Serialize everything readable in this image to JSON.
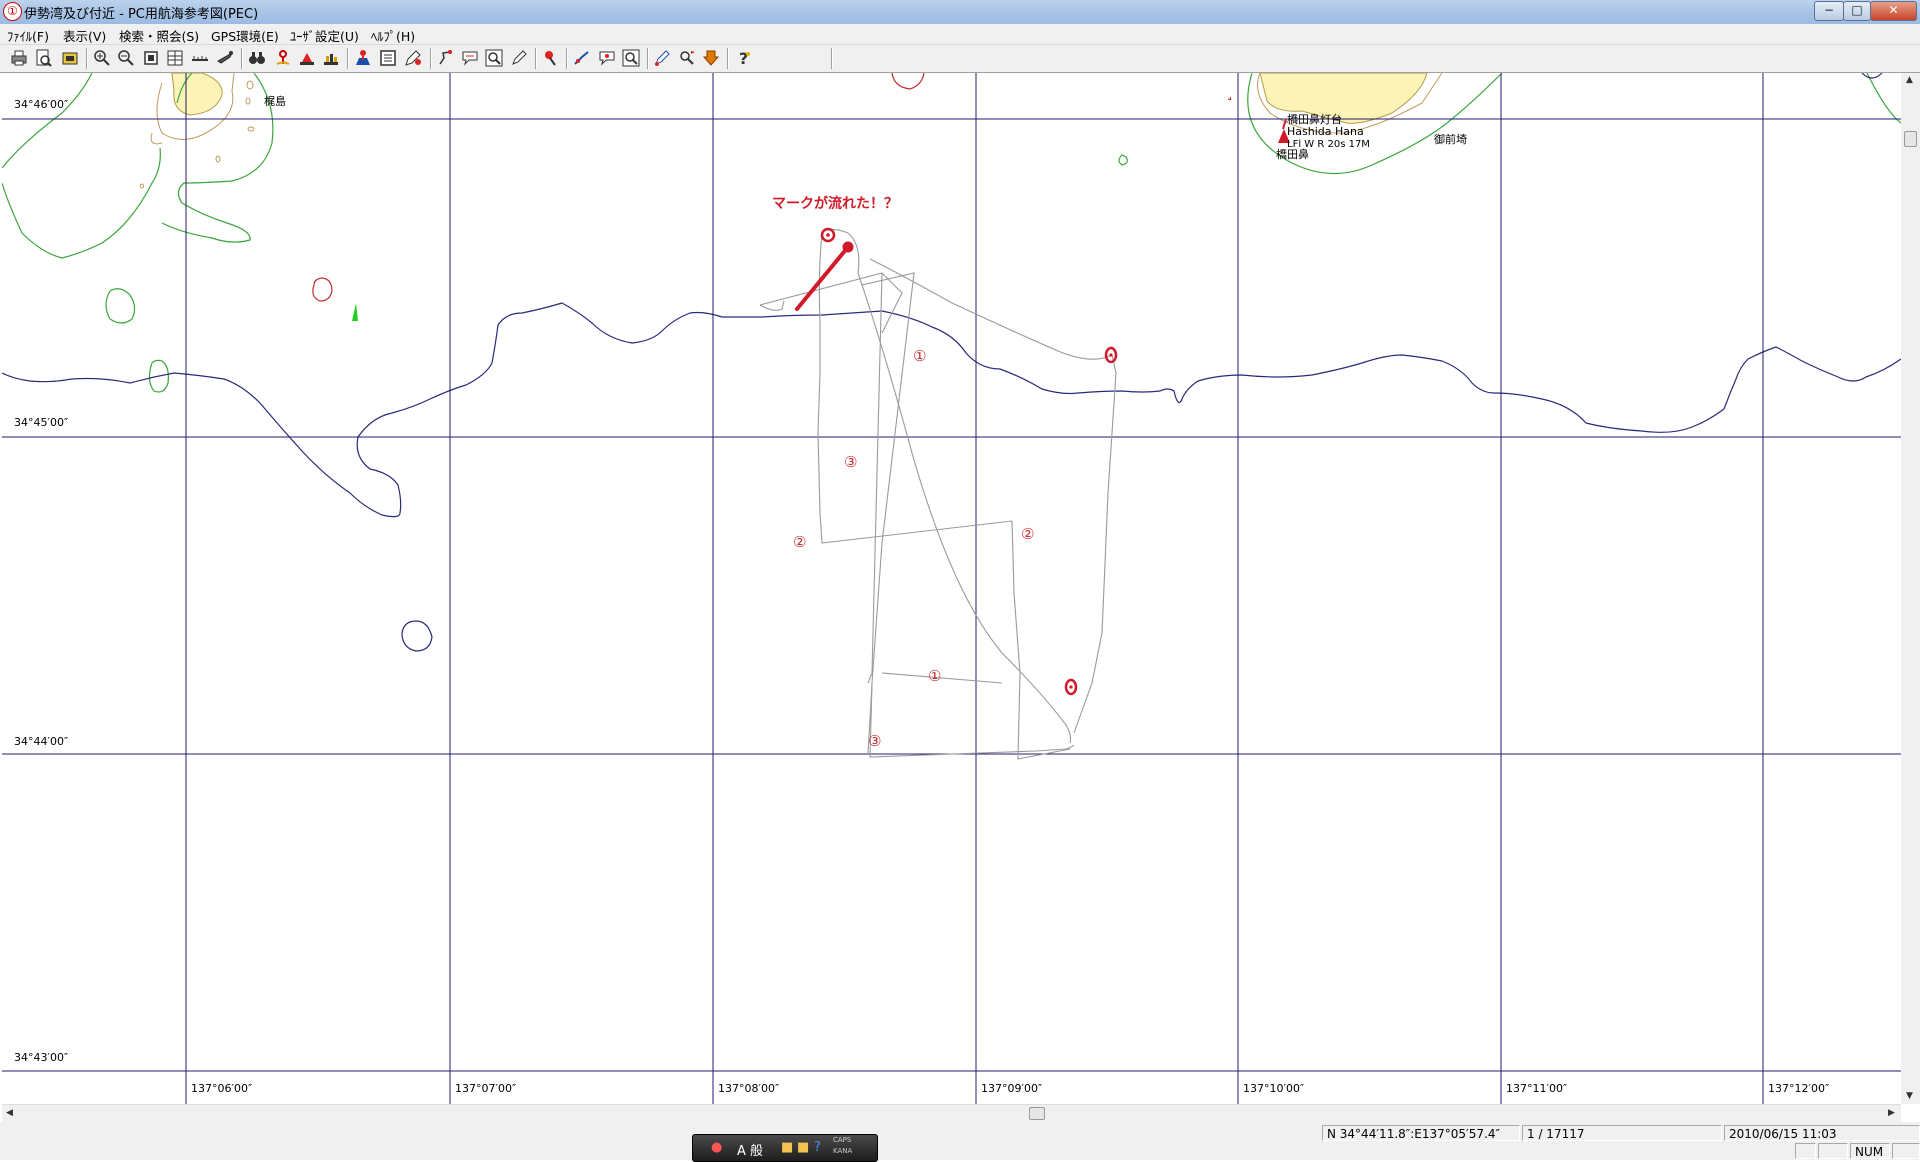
{
  "window": {
    "title": "伊勢湾及び付近 - PC用航海参考図(PEC)",
    "app_icon": "circled-one-icon",
    "controls": {
      "minimize": "−",
      "maximize": "□",
      "close": "✕"
    }
  },
  "menu": [
    "ﾌｧｲﾙ(F)",
    "表示(V)",
    "検索・照会(S)",
    "GPS環境(E)",
    "ﾕｰｻﾞ設定(U)",
    "ﾍﾙﾌﾟ(H)"
  ],
  "toolbar": {
    "icons": [
      "printer-icon",
      "print-preview-icon",
      "save-icon",
      "zoom-in-icon",
      "zoom-out-icon",
      "fit-window-icon",
      "layers-icon",
      "scale-ruler-icon",
      "ship-icon",
      "binoculars-icon",
      "tide-icon",
      "buoy-icon",
      "lighthouse-icon",
      "person-marker-icon",
      "document-icon",
      "edit-mark-icon",
      "route-icon",
      "note-icon",
      "magnifier-icon",
      "pencil-icon",
      "pin-icon",
      "track-icon",
      "comment-icon",
      "search-area-icon",
      "draw-icon",
      "flag-search-icon",
      "arrow-down-icon",
      "help-icon"
    ]
  },
  "chart": {
    "lat_labels": [
      "34°46′00″",
      "34°45′00″",
      "34°44′00″",
      "34°43′00″"
    ],
    "lon_labels": [
      "137°06′00″",
      "137°07′00″",
      "137°08′00″",
      "137°09′00″",
      "137°10′00″",
      "137°11′00″",
      "137°12′00″"
    ],
    "place_labels": {
      "island": "梶島",
      "lighthouse_jp": "橋田鼻灯台",
      "lighthouse_en": "Hashida Hana",
      "light_char": "LFl W R 20s 17M",
      "cape_jp": "橋田鼻",
      "cape2": "御前埼"
    },
    "annotation": "マークが流れた！？",
    "track_marks": [
      {
        "label": "①"
      },
      {
        "label": "③"
      },
      {
        "label": "②"
      },
      {
        "label": "②"
      },
      {
        "label": "①"
      },
      {
        "label": "③"
      }
    ],
    "colors": {
      "grid": "#1d1d6e",
      "depth_contour": "#2a2a7a",
      "shallow_contour": "#3aa53a",
      "land": "#fbf4b6",
      "track": "#9a9a9a",
      "mark": "#d01a2a"
    }
  },
  "statusbar": {
    "position": "N 34°44′11.8″:E137°05′57.4″",
    "scale": "1 / 17117",
    "datetime": "2010/06/15 11:03",
    "num": "NUM"
  },
  "ime_bar": {
    "mode": "A 般",
    "caps": "CAPS",
    "kana": "KANA"
  }
}
